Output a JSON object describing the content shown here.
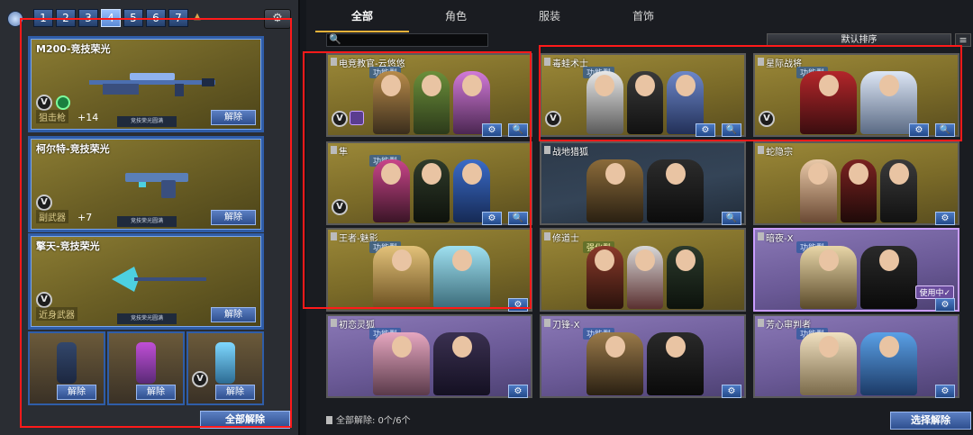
{
  "left_panel": {
    "page_tabs": [
      "1",
      "2",
      "3",
      "4",
      "5",
      "6",
      "7"
    ],
    "active_page": "4",
    "weapons": [
      {
        "name": "M200-竞技荣光",
        "type": "狙击枪",
        "level": "+14",
        "honor": "竞技荣光圆满",
        "release": "解除"
      },
      {
        "name": "柯尔特-竞技荣光",
        "type": "副武器",
        "level": "+7",
        "honor": "竞技荣光圆满",
        "release": "解除"
      },
      {
        "name": "擎天-竞技荣光",
        "type": "近身武器",
        "level": "",
        "honor": "竞技荣光圆满",
        "release": "解除"
      }
    ],
    "grenades": [
      {
        "release": "解除"
      },
      {
        "release": "解除"
      },
      {
        "release": "解除"
      }
    ],
    "release_all": "全部解除"
  },
  "right_panel": {
    "tabs": [
      "全部",
      "角色",
      "服装",
      "首饰"
    ],
    "active_tab": "全部",
    "search_placeholder": "",
    "sort_label": "默认排序",
    "cards": [
      {
        "name": "电竞教官-云悠悠",
        "role": "功能型",
        "style": "gold"
      },
      {
        "name": "毒蛙术士",
        "role": "功能型",
        "style": "gold"
      },
      {
        "name": "星际战将",
        "role": "功能型",
        "style": "gold"
      },
      {
        "name": "隼",
        "role": "功能型",
        "style": "gold"
      },
      {
        "name": "战地猎狐",
        "role": "",
        "style": "dark"
      },
      {
        "name": "蛇隐宗",
        "role": "",
        "style": "gold"
      },
      {
        "name": "王者-魅影",
        "role": "功能型",
        "style": "gold"
      },
      {
        "name": "修道士",
        "role": "强化型",
        "style": "gold"
      },
      {
        "name": "暗夜-X",
        "role": "功能型",
        "style": "purple",
        "in_use": "使用中✓"
      },
      {
        "name": "初恋灵狐",
        "role": "功能型",
        "style": "purple"
      },
      {
        "name": "刀锋-X",
        "role": "功能型",
        "style": "purple"
      },
      {
        "name": "芳心审判者",
        "role": "功能型",
        "style": "purple"
      }
    ],
    "footer_status": "全部解除: 0个/6个",
    "select_release": "选择解除"
  },
  "icons": {
    "v_badge": "V",
    "gear_search": "⚙",
    "magnify": "🔍",
    "menu": "≡"
  },
  "colors": {
    "highlight": "#ff1a1a",
    "accent": "#e6b23a",
    "button_blue": "#2e4f8f"
  }
}
